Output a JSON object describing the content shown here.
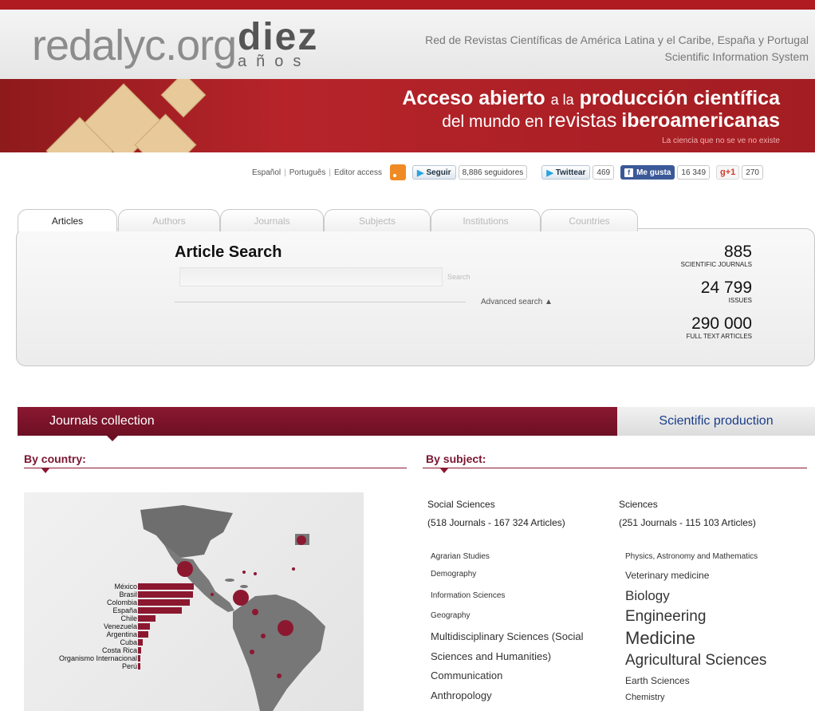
{
  "header": {
    "logo_text": "redalyc.org",
    "logo_badge_top": "diez",
    "logo_badge_bottom": "años",
    "tagline_1": "Red de Revistas Científicas de América Latina y el Caribe, España y Portugal",
    "tagline_2": "Scientific Information System"
  },
  "banner": {
    "line1_bold": "Acceso abierto",
    "line1_small": "a la",
    "line1_bold2": "producción científica",
    "line2_plain": "del mundo en",
    "line2_large": "revistas",
    "line2_bold": "iberoamericanas",
    "line3": "La ciencia que no se ve no existe"
  },
  "social": {
    "lang_es": "Español",
    "lang_pt": "Português",
    "editor": "Editor access",
    "follow": "Seguir",
    "followers": "8,886 seguidores",
    "tweet": "Twittear",
    "tweet_count": "469",
    "like": "Me gusta",
    "like_count": "16 349",
    "gplus": "+1",
    "gplus_count": "270"
  },
  "tabs": [
    "Articles",
    "Authors",
    "Journals",
    "Subjects",
    "Institutions",
    "Countries"
  ],
  "search": {
    "title": "Article Search",
    "placeholder": "",
    "button": "Search",
    "advanced": "Advanced search ▲"
  },
  "stats": [
    {
      "value": "885",
      "label": "SCIENTIFIC JOURNALS"
    },
    {
      "value": "24 799",
      "label": "ISSUES"
    },
    {
      "value": "290 000",
      "label": "FULL TEXT ARTICLES"
    }
  ],
  "sections": {
    "left": "Journals collection",
    "right": "Scientific production",
    "by_country": "By country:",
    "by_subject": "By subject:"
  },
  "countries": [
    {
      "name": "México",
      "value": 100
    },
    {
      "name": "Brasil",
      "value": 99
    },
    {
      "name": "Colombia",
      "value": 93
    },
    {
      "name": "España",
      "value": 78
    },
    {
      "name": "Chile",
      "value": 31
    },
    {
      "name": "Venezuela",
      "value": 22
    },
    {
      "name": "Argentina",
      "value": 18
    },
    {
      "name": "Cuba",
      "value": 9
    },
    {
      "name": "Costa Rica",
      "value": 6
    },
    {
      "name": "Organismo Internacional",
      "value": 4
    },
    {
      "name": "Perú",
      "value": 4
    }
  ],
  "social_sciences": {
    "title": "Social Sciences",
    "counts": "(518 Journals - 167 324 Articles)",
    "items": [
      "Agrarian Studies",
      "Demography",
      "Information Sciences",
      "Geography",
      "Multidisciplinary Sciences (Social",
      "Sciences and Humanities)",
      "Communication",
      "Anthropology"
    ]
  },
  "sciences": {
    "title": "Sciences",
    "counts": "(251 Journals - 115 103 Articles)",
    "items": [
      "Physics, Astronomy and Mathematics",
      "Veterinary medicine",
      "Biology",
      "Engineering",
      "Medicine",
      "Agricultural Sciences",
      "Earth Sciences",
      "Chemistry"
    ]
  }
}
